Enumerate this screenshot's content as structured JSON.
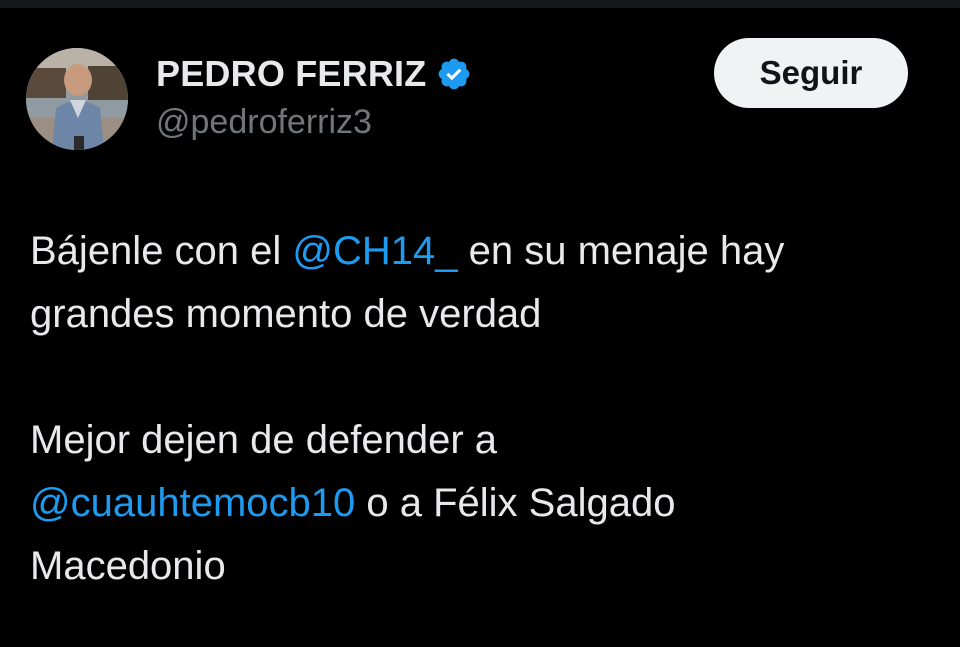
{
  "author": {
    "display_name": "PEDRO FERRIZ",
    "handle": "@pedroferriz3",
    "verified": true,
    "verified_icon": "verified-badge-icon",
    "verified_color": "#1d9bf0"
  },
  "follow_button": {
    "label": "Seguir"
  },
  "tweet": {
    "p1": {
      "t1": "Bájenle con el ",
      "mention": "@CH14_",
      "t2": " en su menaje hay"
    },
    "p1_line2": "grandes momento de verdad",
    "p2_line1": "Mejor dejen de defender a",
    "p2": {
      "mention": "@cuauhtemocb10",
      "t2": " o a Félix Salgado"
    },
    "p2_line3": "Macedonio"
  },
  "colors": {
    "background": "#000000",
    "text": "#e7e9ea",
    "secondary_text": "#71767b",
    "link": "#1d9bf0",
    "button_bg": "#eff3f4",
    "button_text": "#0f1419"
  }
}
